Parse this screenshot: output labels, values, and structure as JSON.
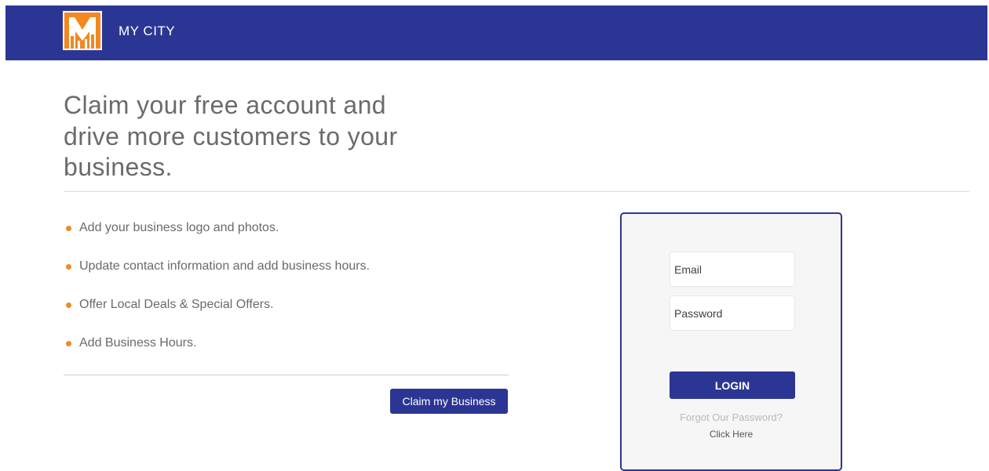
{
  "header": {
    "brand_name": "MY CITY",
    "logo_icon": "city-skyline-m-logo-icon",
    "background_color": "#2b3694",
    "logo_color": "#f2881f"
  },
  "main": {
    "headline": "Claim your free account and drive more customers to your business.",
    "features": [
      {
        "text": "Add your business logo and photos."
      },
      {
        "text": "Update contact information and add business hours."
      },
      {
        "text": "Offer Local Deals & Special Offers."
      },
      {
        "text": "Add Business Hours."
      }
    ],
    "bullet_color": "#f08a2a",
    "claim_button_label": "Claim my Business"
  },
  "login": {
    "email_placeholder": "Email",
    "password_placeholder": "Password",
    "login_label": "LOGIN",
    "forgot_text": "Forgot Our Password?",
    "click_here_label": "Click Here",
    "accent_color": "#2b3694"
  }
}
